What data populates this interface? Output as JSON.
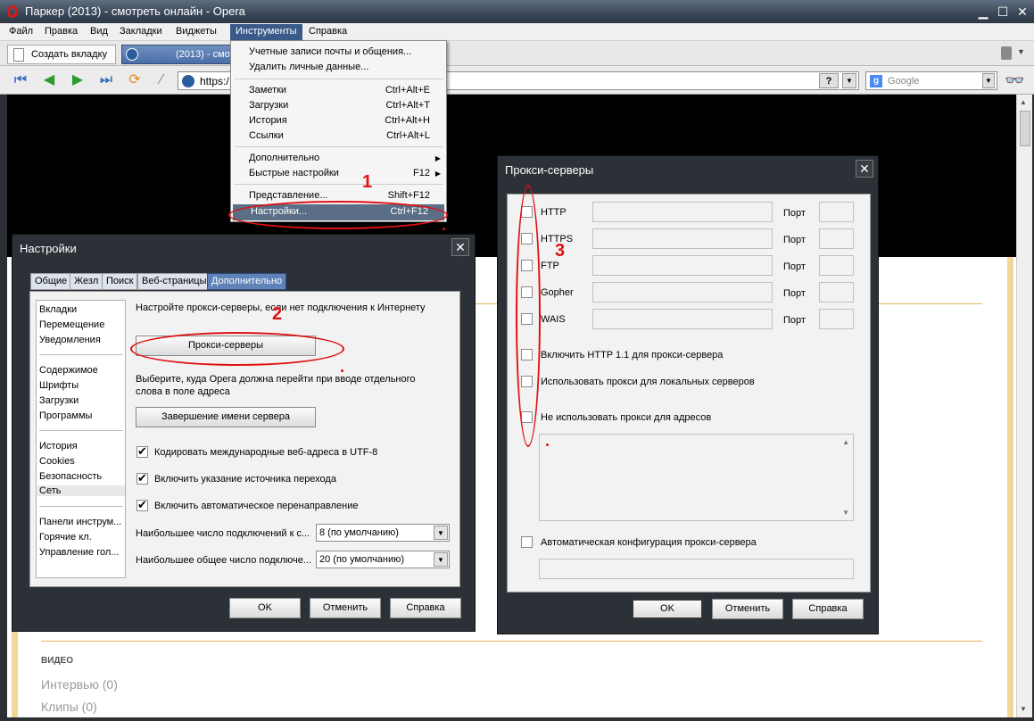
{
  "window": {
    "title": "Паркер (2013) - смотреть онлайн - Opera"
  },
  "menubar": [
    "Файл",
    "Правка",
    "Вид",
    "Закладки",
    "Виджеты",
    "Инструменты",
    "Справка"
  ],
  "tabs": {
    "new_tab": "Создать вкладку",
    "active_tab": "(2013) - смотр"
  },
  "address": {
    "url": "https:/",
    "help": "?"
  },
  "search": {
    "placeholder": "Google"
  },
  "page": {
    "section": "ВИДЕО",
    "links": [
      "Интервью (0)",
      "Клипы (0)"
    ]
  },
  "tools_menu": {
    "items": [
      {
        "label": "Учетные записи почты и общения...",
        "shortcut": ""
      },
      {
        "label": "Удалить личные данные...",
        "shortcut": ""
      },
      {
        "label": "Заметки",
        "shortcut": "Ctrl+Alt+E"
      },
      {
        "label": "Загрузки",
        "shortcut": "Ctrl+Alt+T"
      },
      {
        "label": "История",
        "shortcut": "Ctrl+Alt+H"
      },
      {
        "label": "Ссылки",
        "shortcut": "Ctrl+Alt+L"
      },
      {
        "label": "Дополнительно",
        "shortcut": ""
      },
      {
        "label": "Быстрые настройки",
        "shortcut": "F12"
      },
      {
        "label": "Представление...",
        "shortcut": "Shift+F12"
      },
      {
        "label": "Настройки...",
        "shortcut": "Ctrl+F12"
      }
    ]
  },
  "settings": {
    "title": "Настройки",
    "tabs": [
      "Общие",
      "Жезл",
      "Поиск",
      "Веб-страницы",
      "Дополнительно"
    ],
    "nav": [
      "Вкладки",
      "Перемещение",
      "Уведомления",
      "Содержимое",
      "Шрифты",
      "Загрузки",
      "Программы",
      "История",
      "Cookies",
      "Безопасность",
      "Сеть",
      "Панели инструм...",
      "Горячие кл.",
      "Управление гол..."
    ],
    "proxy_hint": "Настройте прокси-серверы, если нет подключения к Интернету",
    "proxy_button": "Прокси-серверы",
    "server_hint_1": "Выберите, куда Opera должна перейти при вводе отдельного",
    "server_hint_2": "слова в поле адреса",
    "server_button": "Завершение имени сервера",
    "checks": [
      "Кодировать международные веб-адреса в UTF-8",
      "Включить указание источника перехода",
      "Включить автоматическое перенаправление"
    ],
    "max_conn_label": "Наибольшее число подключений к с...",
    "max_conn_value": "8 (по умолчанию)",
    "max_total_label": "Наибольшее общее число подключе...",
    "max_total_value": "20 (по умолчанию)",
    "ok": "OK",
    "cancel": "Отменить",
    "help": "Справка"
  },
  "proxy": {
    "title": "Прокси-серверы",
    "protocols": [
      "HTTP",
      "HTTPS",
      "FTP",
      "Gopher",
      "WAIS"
    ],
    "port": "Порт",
    "opt_http11": "Включить HTTP 1.1 для прокси-сервера",
    "opt_local": "Использовать прокси для локальных серверов",
    "opt_noproxy": "Не использовать прокси для адресов",
    "opt_auto": "Автоматическая конфигурация прокси-сервера",
    "ok": "OK",
    "cancel": "Отменить",
    "help": "Справка"
  },
  "annotations": [
    "1",
    "2",
    "3"
  ],
  "colors": {
    "annotation": "#e01010",
    "title_bar": "#3a4658",
    "selected_tab": "#5f83b8"
  }
}
